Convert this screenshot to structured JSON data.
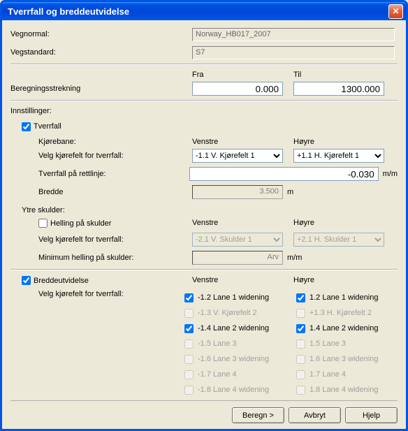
{
  "window": {
    "title": "Tverrfall og breddeutvidelse"
  },
  "labels": {
    "vegnormal": "Vegnormal:",
    "vegstandard": "Vegstandard:",
    "fra": "Fra",
    "til": "Til",
    "beregning": "Beregningsstrekning",
    "innstillinger": "Innstillinger:",
    "tverrfall": "Tverrfall",
    "kjorebane": "Kjørebane:",
    "venstre": "Venstre",
    "hoyre": "Høyre",
    "velg_kjorefelt": "Velg kjørefelt for tverrfall:",
    "tverrfall_rettlinje": "Tverrfall på rettlinje:",
    "bredde": "Bredde",
    "ytre_skulder": "Ytre skulder:",
    "helling_skulder": "Helling på skulder",
    "min_helling": "Minimum helling på skulder:",
    "breddeutvidelse": "Breddeutvidelse",
    "mm": "m/m",
    "m": "m",
    "arv": "Arv"
  },
  "values": {
    "vegnormal": "Norway_HB017_2007",
    "vegstandard": "S7",
    "fra": "0.000",
    "til": "1300.000",
    "tverrfall_rettlinje": "-0.030",
    "bredde": "3.500",
    "lane_left": "-1.1 V. Kjørefelt 1",
    "lane_right": "+1.1 H. Kjørefelt 1",
    "sk_left": "-2.1 V. Skulder 1",
    "sk_right": "+2.1 H. Skulder 1"
  },
  "widening": {
    "left": [
      {
        "label": "-1.2 Lane 1 widening",
        "checked": true,
        "enabled": true
      },
      {
        "label": "-1.3 V. Kjørefelt 2",
        "checked": false,
        "enabled": false
      },
      {
        "label": "-1.4 Lane 2 widening",
        "checked": true,
        "enabled": true
      },
      {
        "label": "-1.5 Lane 3",
        "checked": false,
        "enabled": false
      },
      {
        "label": "-1.6 Lane 3 widening",
        "checked": false,
        "enabled": false
      },
      {
        "label": "-1.7 Lane 4",
        "checked": false,
        "enabled": false
      },
      {
        "label": "-1.8 Lane 4 widening",
        "checked": false,
        "enabled": false
      }
    ],
    "right": [
      {
        "label": "1.2 Lane 1 widening",
        "checked": true,
        "enabled": true
      },
      {
        "label": "+1.3 H. Kjørefelt 2",
        "checked": false,
        "enabled": false
      },
      {
        "label": "1.4 Lane 2 widening",
        "checked": true,
        "enabled": true
      },
      {
        "label": "1.5 Lane 3",
        "checked": false,
        "enabled": false
      },
      {
        "label": "1.6 Lane 3 widening",
        "checked": false,
        "enabled": false
      },
      {
        "label": "1.7 Lane 4",
        "checked": false,
        "enabled": false
      },
      {
        "label": "1.8 Lane 4 widening",
        "checked": false,
        "enabled": false
      }
    ]
  },
  "buttons": {
    "beregn": "Beregn >",
    "avbryt": "Avbryt",
    "hjelp": "Hjelp"
  }
}
